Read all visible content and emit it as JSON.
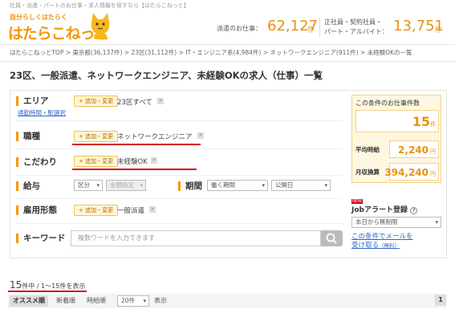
{
  "header": {
    "topline": "社員・派遣・パートのお仕事・求人情報を探すなら【はたらこねっと】",
    "logo_small": "自分らしくはたらく",
    "logo_main": "はたらこねっと",
    "stat1_label": "派遣のお仕事：",
    "stat1_num": "62,127",
    "stat1_unit": "件",
    "stat2_label1": "正社員・契約社員・",
    "stat2_label2": "パート・アルバイト：",
    "stat2_num": "13,751",
    "stat2_unit": "件"
  },
  "breadcrumb": "はたらこねっとTOP > 東京都(36,137件) > 23区(31,112件) > IT・エンジニア系(4,984件) > ネットワークエンジニア(911件) > 未経験OKの一覧",
  "page_title": "23区、一般派遣、ネットワークエンジニア、未経験OKの求人（仕事）一覧",
  "filters": {
    "area_label": "エリア",
    "add_label": "+ 追加・変更",
    "area_value": "23区すべて",
    "commute_link": "通勤時間・駅選択",
    "job_label": "職種",
    "job_value": "ネットワークエンジニア",
    "kodawari_label": "こだわり",
    "kodawari_value": "未経験OK",
    "salary_label": "給与",
    "salary_type": "区分",
    "salary_amount": "金額指定",
    "period_label": "期間",
    "period_value": "働く期間",
    "start_value": "公開日",
    "employment_label": "雇用形態",
    "employment_value": "一般派遣",
    "keyword_label": "キーワード",
    "keyword_placeholder": "複数ワードを入力できます"
  },
  "side": {
    "title": "この条件のお仕事件数",
    "count": "15",
    "count_unit": "件",
    "hourly_label": "平均時給",
    "hourly_value": "2,240",
    "yen": "円",
    "monthly_label1": "月収換算",
    "monthly_value": "394,240",
    "new_badge": "NEW",
    "alert_title": "Jobアラート登録",
    "alert_select": "本日から無制限",
    "alert_link1": "この条件でメールを",
    "alert_link2": "受け取る",
    "alert_free": "（無料）"
  },
  "results": {
    "count": "15",
    "count_suffix": "件中 / 1〜15件を表示",
    "sort_recommended": "オススメ順",
    "sort_new": "新着順",
    "sort_wage": "時給順",
    "per_page": "20件",
    "display_label": "表示",
    "page": "1"
  }
}
